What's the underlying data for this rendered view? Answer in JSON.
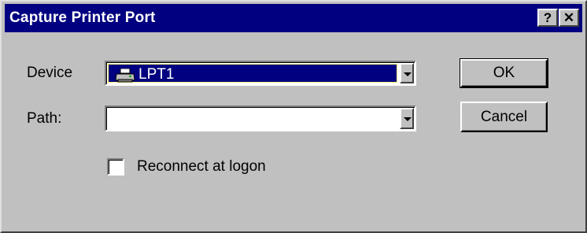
{
  "window": {
    "title": "Capture Printer Port",
    "help_label": "?",
    "close_label": "✕"
  },
  "device": {
    "label": "Device",
    "value": "LPT1",
    "icon": "printer-icon"
  },
  "path": {
    "label": "Path:",
    "value": ""
  },
  "reconnect": {
    "label": "Reconnect at logon",
    "checked": false
  },
  "buttons": {
    "ok": "OK",
    "cancel": "Cancel"
  },
  "colors": {
    "titlebar": "#000080",
    "face": "#c0c0c0",
    "selection": "#000080"
  }
}
